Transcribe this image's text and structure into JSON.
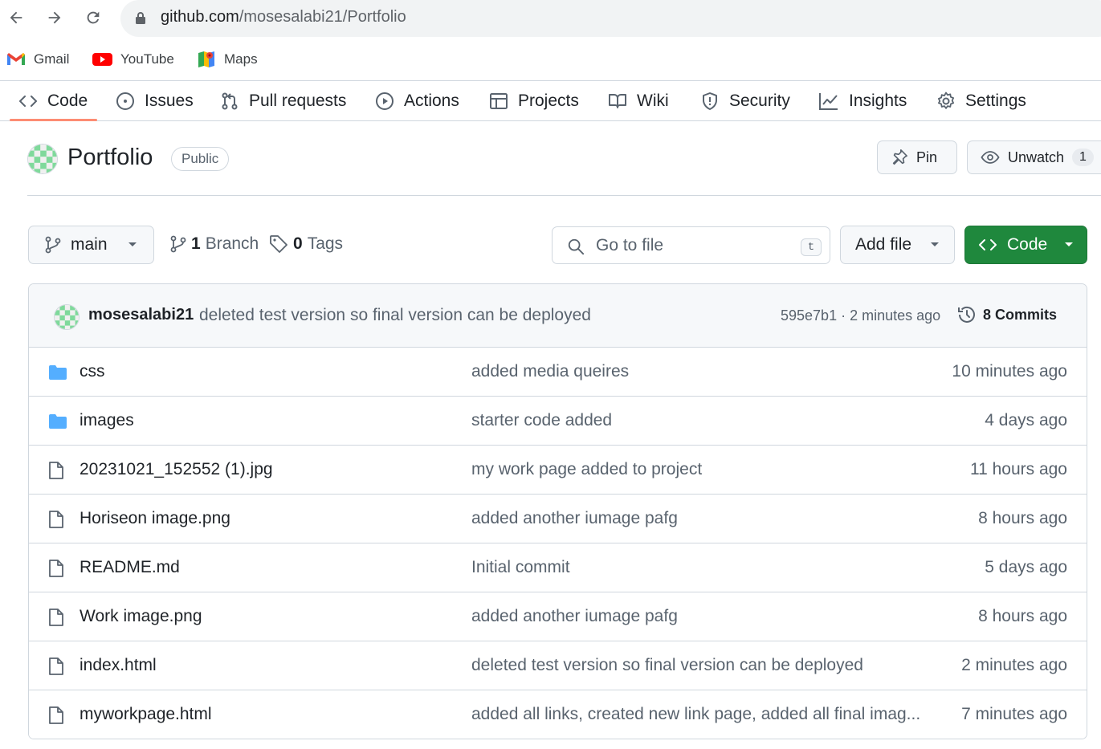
{
  "browser": {
    "url_host": "github.com",
    "url_path": "/mosesalabi21/Portfolio",
    "bookmarks": [
      {
        "label": "Gmail",
        "icon": "gmail-icon"
      },
      {
        "label": "YouTube",
        "icon": "youtube-icon"
      },
      {
        "label": "Maps",
        "icon": "maps-icon"
      }
    ]
  },
  "repo_nav": {
    "tabs": [
      {
        "label": "Code",
        "icon": "code-icon",
        "active": true
      },
      {
        "label": "Issues",
        "icon": "issue-icon"
      },
      {
        "label": "Pull requests",
        "icon": "pull-request-icon"
      },
      {
        "label": "Actions",
        "icon": "play-icon"
      },
      {
        "label": "Projects",
        "icon": "table-icon"
      },
      {
        "label": "Wiki",
        "icon": "book-icon"
      },
      {
        "label": "Security",
        "icon": "shield-icon"
      },
      {
        "label": "Insights",
        "icon": "graph-icon"
      },
      {
        "label": "Settings",
        "icon": "gear-icon"
      }
    ]
  },
  "repo": {
    "name": "Portfolio",
    "visibility": "Public",
    "pin_label": "Pin",
    "watch_label": "Unwatch",
    "watch_count": "1"
  },
  "toolbar": {
    "branch": "main",
    "branch_count": "1",
    "branch_label": "Branch",
    "tag_count": "0",
    "tag_label": "Tags",
    "search_placeholder": "Go to file",
    "search_shortcut": "t",
    "add_file_label": "Add file",
    "code_label": "Code"
  },
  "latest_commit": {
    "author": "mosesalabi21",
    "message": "deleted test version so final version can be deployed",
    "meta": "595e7b1 · 2 minutes ago",
    "commits_label": "8 Commits"
  },
  "files": [
    {
      "type": "folder",
      "name": "css",
      "message": "added media queires",
      "date": "10 minutes ago"
    },
    {
      "type": "folder",
      "name": "images",
      "message": "starter code added",
      "date": "4 days ago"
    },
    {
      "type": "file",
      "name": "20231021_152552 (1).jpg",
      "message": "my work page added to project",
      "date": "11 hours ago"
    },
    {
      "type": "file",
      "name": "Horiseon image.png",
      "message": "added another iumage pafg",
      "date": "8 hours ago"
    },
    {
      "type": "file",
      "name": "README.md",
      "message": "Initial commit",
      "date": "5 days ago"
    },
    {
      "type": "file",
      "name": "Work image.png",
      "message": "added another iumage pafg",
      "date": "8 hours ago"
    },
    {
      "type": "file",
      "name": "index.html",
      "message": "deleted test version so final version can be deployed",
      "date": "2 minutes ago"
    },
    {
      "type": "file",
      "name": "myworkpage.html",
      "message": "added all links, created new link page, added all final imag...",
      "date": "7 minutes ago"
    }
  ],
  "colors": {
    "accent_green": "#1f883d",
    "folder_blue": "#54aeff",
    "tab_underline": "#fd8c73"
  }
}
